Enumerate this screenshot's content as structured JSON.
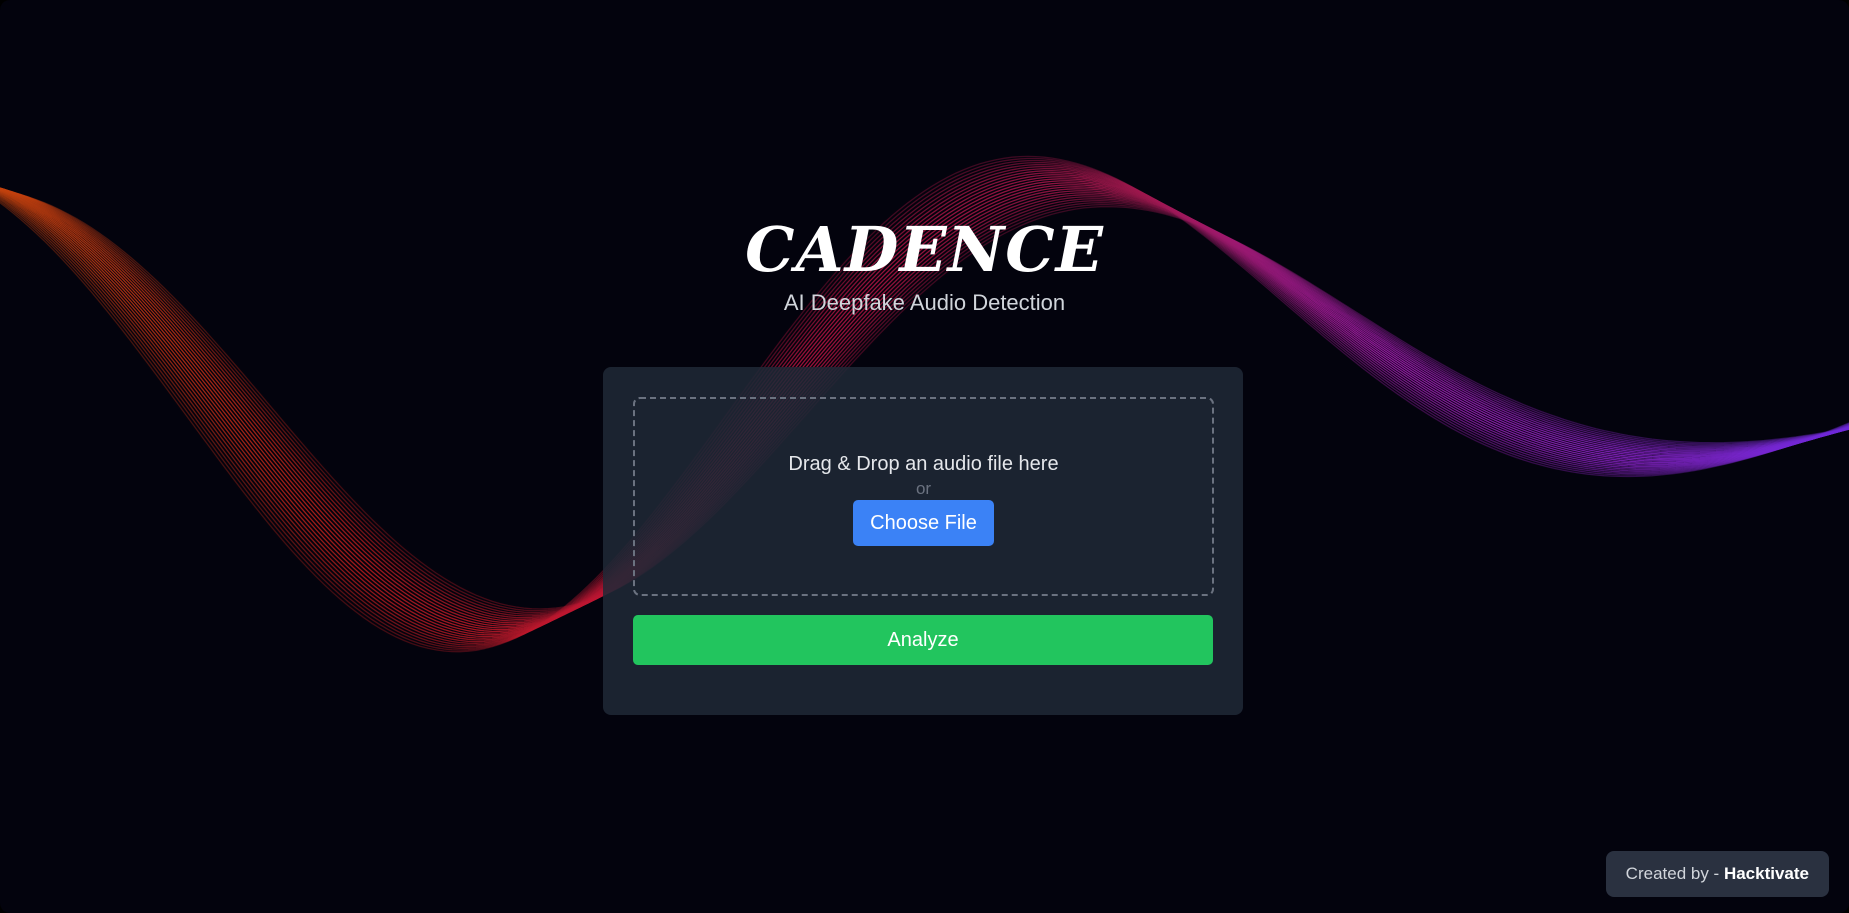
{
  "header": {
    "title": "CADENCE",
    "subtitle": "AI Deepfake Audio Detection"
  },
  "upload": {
    "drop_text": "Drag & Drop an audio file here",
    "or_text": "or",
    "choose_label": "Choose File"
  },
  "actions": {
    "analyze_label": "Analyze"
  },
  "footer": {
    "credit_prefix": "Created by - ",
    "credit_name": "Hacktivate"
  },
  "colors": {
    "background": "#03030d",
    "card": "#1f2937",
    "choose_button": "#3b82f6",
    "analyze_button": "#22c55e",
    "wave_orange": "#c2410c",
    "wave_red": "#be123c",
    "wave_purple": "#a21caf",
    "wave_violet": "#7e22ce"
  }
}
